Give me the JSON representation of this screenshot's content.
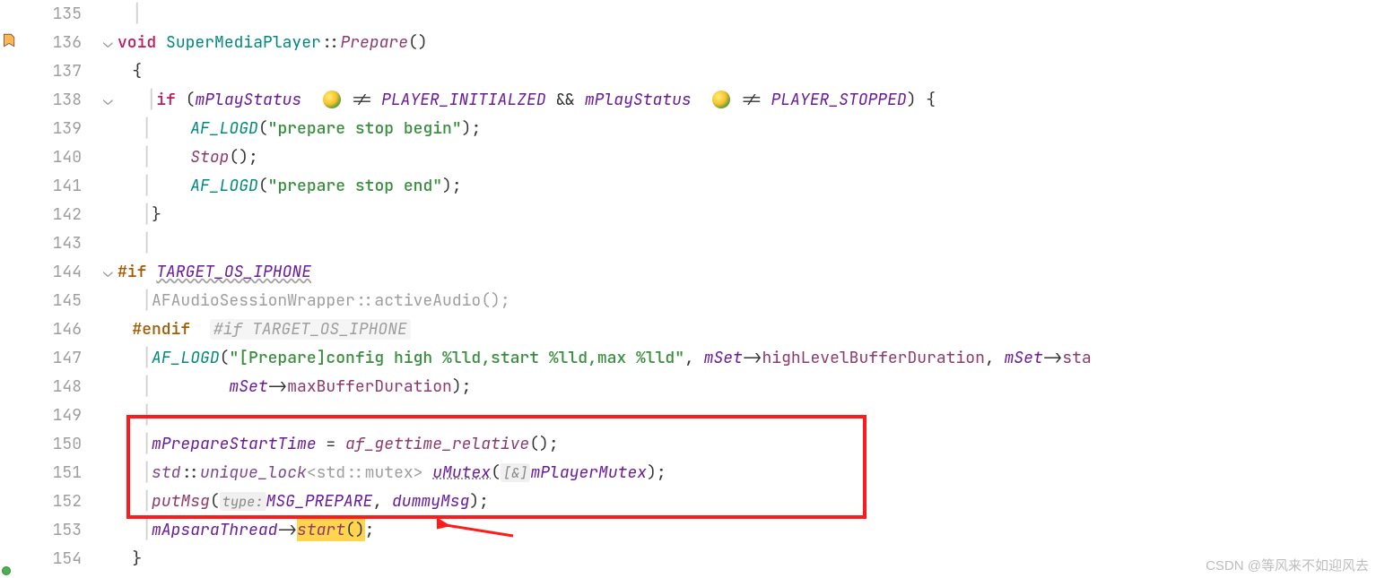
{
  "lines": {
    "135": {
      "num": "135"
    },
    "136": {
      "num": "136",
      "void": "void",
      "class": "SuperMediaPlayer",
      "sep": "::",
      "method": "Prepare",
      "parens": "()"
    },
    "137": {
      "num": "137",
      "brace": "{"
    },
    "138": {
      "num": "138",
      "if": "if",
      "open": " (",
      "v1": "mPlayStatus",
      "ne1": " != ",
      "c1": "PLAYER_INITIALZED",
      "and": " && ",
      "v2": "mPlayStatus",
      "ne2": " != ",
      "c2": "PLAYER_STOPPED",
      "close": ") {"
    },
    "139": {
      "num": "139",
      "fn": "AF_LOGD",
      "open": "(",
      "s": "\"prepare stop begin\"",
      "close": ");"
    },
    "140": {
      "num": "140",
      "fn": "Stop",
      "close": "();"
    },
    "141": {
      "num": "141",
      "fn": "AF_LOGD",
      "open": "(",
      "s": "\"prepare stop end\"",
      "close": ");"
    },
    "142": {
      "num": "142",
      "brace": "}"
    },
    "143": {
      "num": "143"
    },
    "144": {
      "num": "144",
      "pre": "#if ",
      "name": "TARGET_OS_IPHONE"
    },
    "145": {
      "num": "145",
      "txt": "AFAudioSessionWrapper::activeAudio();"
    },
    "146": {
      "num": "146",
      "pre": "#endif",
      "hint": "#if TARGET_OS_IPHONE"
    },
    "147": {
      "num": "147",
      "fn": "AF_LOGD",
      "open": "(",
      "s": "\"[Prepare]config high %lld,start %lld,max %lld\"",
      "c": ", ",
      "m1": "mSet",
      "arr": "->",
      "f1": "highLevelBufferDuration",
      "c2": ", ",
      "m2": "mSet",
      "arr2": "->",
      "f2": "sta"
    },
    "148": {
      "num": "148",
      "m": "mSet",
      "arr": "->",
      "f": "maxBufferDuration",
      "close": ");"
    },
    "149": {
      "num": "149"
    },
    "150": {
      "num": "150",
      "v": "mPrepareStartTime",
      "eq": " = ",
      "fn": "af_gettime_relative",
      "close": "();"
    },
    "151": {
      "num": "151",
      "ns": "std",
      "sep": "::",
      "tpl": "unique_lock",
      "lt": "<",
      "ns2": "std",
      "sep2": "::",
      "t2": "mutex",
      "gt": "> ",
      "var": "uMutex",
      "open": "(",
      "hint": "[&]",
      "arg": "mPlayerMutex",
      "close": ");"
    },
    "152": {
      "num": "152",
      "fn": "putMsg",
      "open": "(",
      "hint": "type:",
      "c1": "MSG_PREPARE",
      "comma": ", ",
      "a2": "dummyMsg",
      "close": ");"
    },
    "153": {
      "num": "153",
      "v": "mApsaraThread",
      "arr": "->",
      "fn": "start",
      "parens": "()",
      "semi": ";"
    },
    "154": {
      "num": "154",
      "brace": "}"
    }
  },
  "watermark": "CSDN @等风来不如迎风去"
}
